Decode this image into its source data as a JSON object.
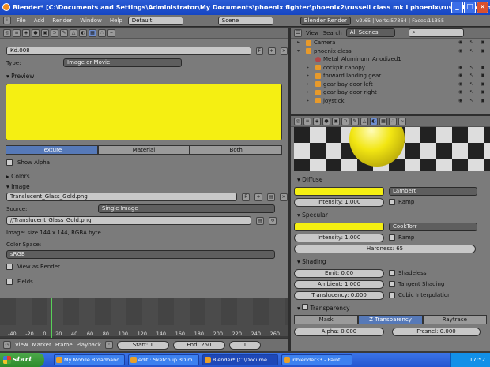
{
  "window": {
    "title": "Blender* [C:\\Documents and Settings\\Administrator\\My Documents\\phoenix fighter\\phoenix2\\russell class mk i phoenix\\russell class mk i phoenix.blend]"
  },
  "menubar": {
    "items": [
      "File",
      "Add",
      "Render",
      "Window",
      "Help"
    ],
    "layout": "Default",
    "scene": "Scene",
    "engine": "Blender Render",
    "stats": "v2.65 | Verts:57364 | Faces:11355"
  },
  "texture_panel": {
    "texture_name": "Kd.008",
    "type_label": "Type:",
    "type_value": "Image or Movie",
    "preview_label": "Preview",
    "preview_tabs": [
      "Texture",
      "Material",
      "Both"
    ],
    "show_alpha": "Show Alpha",
    "colors_label": "Colors",
    "image_label": "Image",
    "image_name": "Translucent_Glass_Gold.png",
    "source_label": "Source:",
    "source_value": "Single Image",
    "filepath": "//Translucent_Glass_Gold.png",
    "image_info": "Image: size 144 x 144, RGBA byte",
    "colorspace_label": "Color Space:",
    "colorspace_value": "sRGB",
    "view_as_render": "View as Render",
    "fields": "Fields"
  },
  "timeline": {
    "ticks": [
      "-40",
      "-20",
      "0",
      "20",
      "40",
      "60",
      "80",
      "100",
      "120",
      "140",
      "160",
      "180",
      "200",
      "220",
      "240",
      "260"
    ],
    "menu": [
      "View",
      "Marker",
      "Frame",
      "Playback"
    ],
    "start": "Start: 1",
    "end": "End: 250",
    "current": "1"
  },
  "outliner": {
    "header": {
      "view": "View",
      "search": "Search",
      "scope": "All Scenes"
    },
    "items": [
      {
        "label": "Camera",
        "indent": 1
      },
      {
        "label": "phoenix class",
        "indent": 1
      },
      {
        "label": "Metal_Aluminum_Anodized1",
        "indent": 2
      },
      {
        "label": "cockpit canopy",
        "indent": 2
      },
      {
        "label": "forward landing gear",
        "indent": 2
      },
      {
        "label": "gear bay door left",
        "indent": 2
      },
      {
        "label": "gear bay door right",
        "indent": 2
      },
      {
        "label": "joystick",
        "indent": 2
      }
    ]
  },
  "material": {
    "diffuse_label": "Diffuse",
    "diffuse_intensity": "Intensity: 1.000",
    "diffuse_shader": "Lambert",
    "ramp": "Ramp",
    "specular_label": "Specular",
    "specular_intensity": "Intensity: 1.000",
    "specular_shader": "CookTorr",
    "hardness": "Hardness: 65",
    "shading_label": "Shading",
    "emit": "Emit: 0.00",
    "ambient": "Ambient: 1.000",
    "translucency": "Translucency: 0.000",
    "shadeless": "Shadeless",
    "tangent": "Tangent Shading",
    "cubic": "Cubic Interpolation",
    "transparency_label": "Transparency",
    "trans_tabs": [
      "Mask",
      "Z Transparency",
      "Raytrace"
    ],
    "alpha": "Alpha: 0.000",
    "fresnel": "Fresnel: 0.000",
    "diffuse_color": "#f5ef12",
    "specular_color": "#f5ef12"
  },
  "taskbar": {
    "start": "start",
    "tasks": [
      "My Mobile Broadband...",
      "edit : Sketchup 3D m...",
      "Blender* [C:\\Docume...",
      "inblender33 - Paint"
    ],
    "time": "17:52"
  }
}
